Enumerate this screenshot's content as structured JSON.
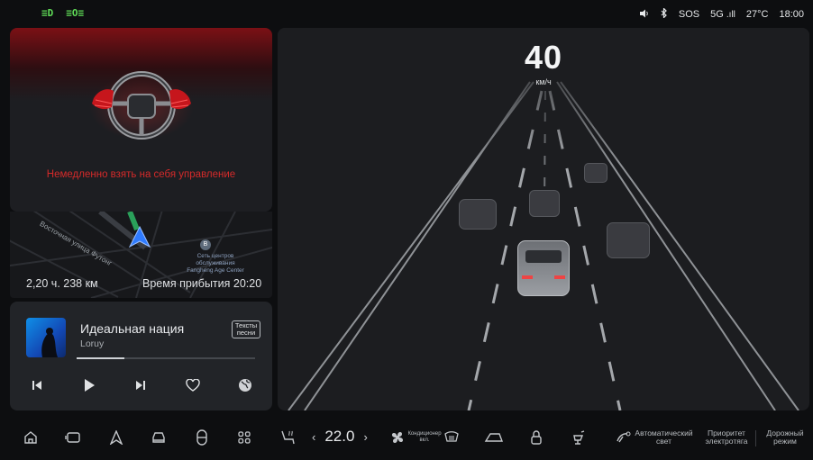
{
  "status": {
    "headlight_icon": "low-beam-icon",
    "foglight_icon": "parking-light-icon",
    "sos": "SOS",
    "network": "5G",
    "temperature": "27°C",
    "time": "18:00"
  },
  "warning": {
    "message": "Немедленно взять на себя управление"
  },
  "navigation": {
    "street": "Восточная улица Футонг",
    "poi_line1": "Сеть центров",
    "poi_line2": "обслуживания",
    "poi_line3": "Fangheng Age Center",
    "remaining": "2,20 ч. 238 км",
    "arrival": "Время прибытия 20:20"
  },
  "media": {
    "title": "Идеальная нация",
    "artist": "Loruy",
    "lyrics_label_1": "Тексты",
    "lyrics_label_2": "песни",
    "progress": 0.27
  },
  "drive": {
    "speed": "40",
    "unit": "км/ч"
  },
  "dock": {
    "temperature_value": "22.0",
    "ac_label_1": "Кондиционер",
    "ac_label_2": "вкл.",
    "auto_light_1": "Автоматический",
    "auto_light_2": "свет",
    "priority_1": "Приоритет",
    "priority_2": "электротяга",
    "road_mode_1": "Дорожный",
    "road_mode_2": "режим"
  },
  "colors": {
    "warning_red": "#d52a2a",
    "indicator_green": "#5fdc57",
    "nav_arrow_blue": "#2f7bff"
  }
}
